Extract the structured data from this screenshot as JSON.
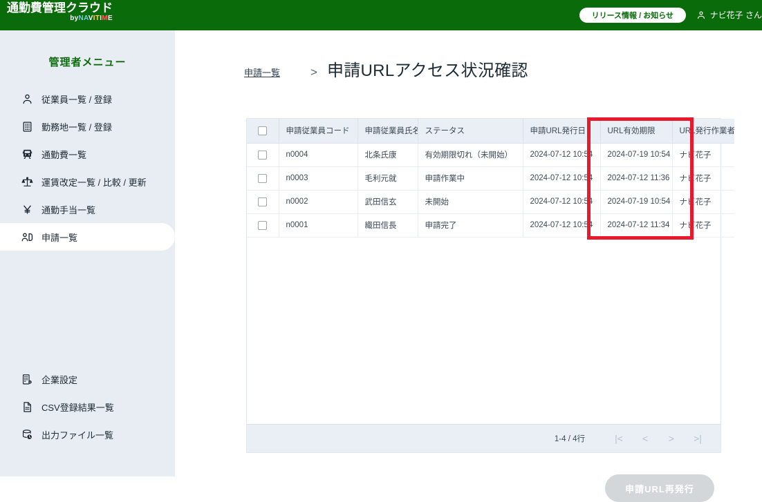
{
  "header": {
    "brand_main": "通勤費管理クラウド",
    "brand_by": "by",
    "brand_n1": "NA",
    "brand_n2": "V",
    "brand_n3": "IT",
    "brand_n4": "I",
    "brand_n5": "M",
    "brand_n6": "E",
    "news_label": "リリース情報 / お知らせ",
    "user_name": "ナビ花子 さん",
    "green": "#0a6b0a"
  },
  "sidebar": {
    "title": "管理者メニュー",
    "items": [
      {
        "label": "従業員一覧 / 登録",
        "icon": "person-icon",
        "active": false
      },
      {
        "label": "勤務地一覧 / 登録",
        "icon": "building-icon",
        "active": false
      },
      {
        "label": "通勤費一覧",
        "icon": "train-icon",
        "active": false
      },
      {
        "label": "運賃改定一覧 / 比較 / 更新",
        "icon": "scale-icon",
        "active": false
      },
      {
        "label": "通勤手当一覧",
        "icon": "yen-icon",
        "active": false
      },
      {
        "label": "申請一覧",
        "icon": "application-list-icon",
        "active": true
      }
    ],
    "bottom_items": [
      {
        "label": "企業設定",
        "icon": "building-gear-icon"
      },
      {
        "label": "CSV登録結果一覧",
        "icon": "document-icon"
      },
      {
        "label": "出力ファイル一覧",
        "icon": "database-clock-icon"
      }
    ]
  },
  "breadcrumb": {
    "parent": "申請一覧",
    "separator": ">",
    "current": "申請URLアクセス状況確認"
  },
  "table": {
    "columns": [
      "",
      "申請従業員コード",
      "申請従業員氏名",
      "ステータス",
      "申請URL発行日",
      "URL有効期限",
      "URL発行作業者"
    ],
    "rows": [
      {
        "code": "n0004",
        "name": "北条氏康",
        "status": "有効期限切れ（未開始）",
        "issued": "2024-07-12 10:54",
        "expires": "2024-07-19 10:54",
        "worker": "ナビ花子"
      },
      {
        "code": "n0003",
        "name": "毛利元就",
        "status": "申請作業中",
        "issued": "2024-07-12 10:54",
        "expires": "2024-07-12 11:36",
        "worker": "ナビ花子"
      },
      {
        "code": "n0002",
        "name": "武田信玄",
        "status": "未開始",
        "issued": "2024-07-12 10:54",
        "expires": "2024-07-19 10:54",
        "worker": "ナビ花子"
      },
      {
        "code": "n0001",
        "name": "織田信長",
        "status": "申請完了",
        "issued": "2024-07-12 10:54",
        "expires": "2024-07-12 11:34",
        "worker": "ナビ花子"
      }
    ],
    "footer": {
      "page_count": "1-4 / 4行",
      "first_label": "|<",
      "prev_label": "<",
      "next_label": ">",
      "last_label": ">|"
    }
  },
  "annotation": {
    "highlight_color": "#e8192c",
    "highlight_target": "ステータス"
  },
  "action": {
    "reissue_label": "申請URL再発行"
  }
}
